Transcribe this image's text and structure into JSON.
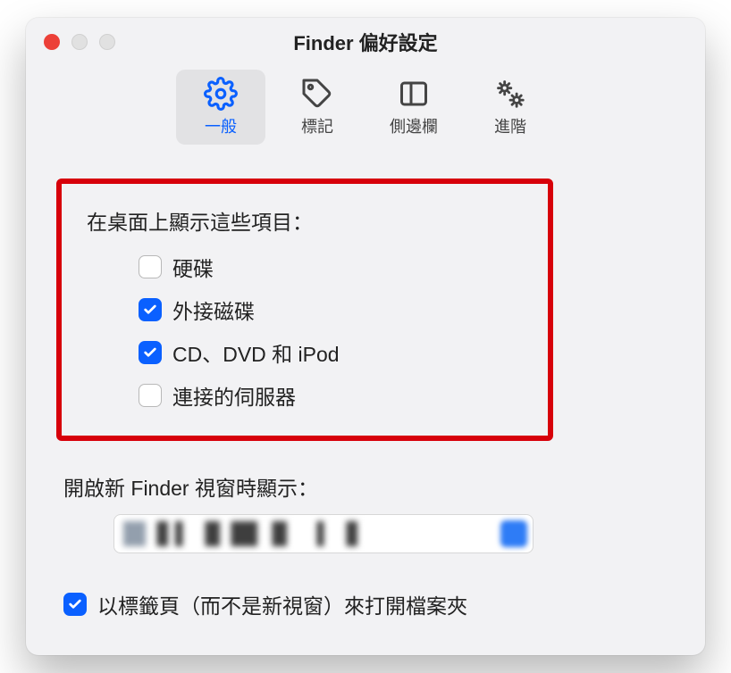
{
  "window": {
    "title": "Finder 偏好設定"
  },
  "tabs": {
    "general": "一般",
    "tags": "標記",
    "sidebar": "側邊欄",
    "advanced": "進階"
  },
  "general": {
    "desktop_section_label": "在桌面上顯示這些項目：",
    "items": {
      "hd": {
        "label": "硬碟",
        "checked": false
      },
      "ext": {
        "label": "外接磁碟",
        "checked": true
      },
      "cd": {
        "label": "CD、DVD 和 iPod",
        "checked": true
      },
      "servers": {
        "label": "連接的伺服器",
        "checked": false
      }
    },
    "new_window_label": "開啟新 Finder 視窗時顯示：",
    "open_in_tabs": {
      "label": "以標籤頁（而不是新視窗）來打開檔案夾",
      "checked": true
    }
  }
}
